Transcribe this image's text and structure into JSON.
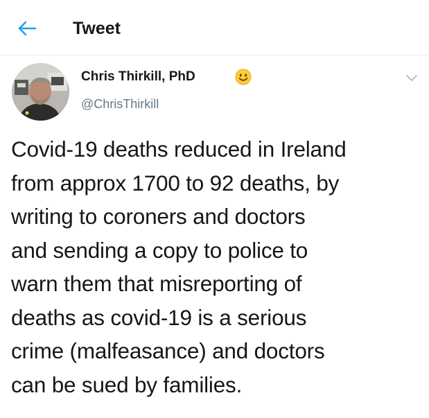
{
  "header": {
    "title": "Tweet",
    "back_icon": "arrow-left-icon",
    "accent_color": "#1da1f2"
  },
  "tweet": {
    "author_name": "Chris Thirkill, PhD",
    "author_handle": "@ChrisThirkill",
    "name_emoji": "smiling-face-emoji",
    "menu_icon": "chevron-down-icon",
    "text": "Covid-19 deaths reduced in Ireland\nfrom approx 1700 to 92 deaths, by\nwriting to coroners and doctors\nand sending a copy to police to\nwarn them that misreporting of\ndeaths as covid-19 is a serious\ncrime (malfeasance) and doctors\ncan be sued by families."
  }
}
